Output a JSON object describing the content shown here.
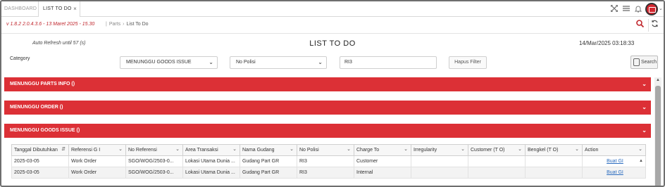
{
  "tabs": {
    "dashboard": "DASHBOARD",
    "active": "LIST TO DO",
    "close": "×"
  },
  "toolbar_icons": [
    "expand-icon",
    "menu-icon",
    "bell-icon",
    "user-icon"
  ],
  "breadcrumb": {
    "version": "v 1.8.2 2.0.4.3.6 - 13 Maret 2025 - 15.30",
    "parts": "Parts",
    "current": "List To Do"
  },
  "header": {
    "auto_refresh": "Auto Refresh until 57 (s)",
    "title": "LIST TO DO",
    "datetime": "14/Mar/2025 03:18:33"
  },
  "filters": {
    "category_label": "Category",
    "category_value": "MENUNGGU GOODS ISSUE",
    "no_polisi_value": "No Polisi",
    "text_value": "RI3",
    "hapus_label": "Hapus Filter",
    "search_label": "Search"
  },
  "accordions": [
    {
      "label": "MENUNGGU PARTS INFO ()"
    },
    {
      "label": "MENUNGGU ORDER ()"
    },
    {
      "label": "MENUNGGU GOODS ISSUE ()"
    }
  ],
  "table": {
    "columns": [
      "Tanggal Dibutuhkan",
      "Referensi G I",
      "No Referensi",
      "Area Transaksi",
      "Nama Gudang",
      "No Polisi",
      "Charge To",
      "Irregularity",
      "Customer (T O)",
      "Bengkel (T O)",
      "Action"
    ],
    "rows": [
      [
        "2025-03-05",
        "Work Order",
        "SGO/WOG/2503-0...",
        "Lokasi Utama Dunia ...",
        "Gudang Part GR",
        "RI3",
        "Customer",
        "",
        "",
        "",
        "Buat GI"
      ],
      [
        "2025-03-05",
        "Work Order",
        "SGO/WOG/2503-0...",
        "Lokasi Utama Dunia ...",
        "Gudang Part GR",
        "RI3",
        "Internal",
        "",
        "",
        "",
        "Buat GI"
      ]
    ]
  },
  "colors": {
    "accent": "#dc3036",
    "version_text": "#c0262d",
    "link": "#2a6bbf"
  }
}
